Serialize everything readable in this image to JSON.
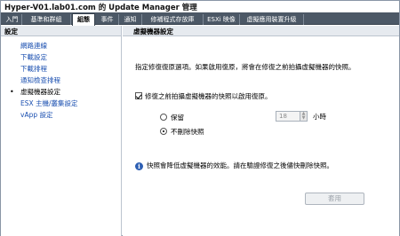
{
  "window": {
    "title": "Hyper-V01.lab01.com 的 Update Manager 管理"
  },
  "tabs": [
    {
      "label": "入門"
    },
    {
      "label": "基準和群組"
    },
    {
      "label": "組態"
    },
    {
      "label": "事件"
    },
    {
      "label": "通知"
    },
    {
      "label": "修補程式存放庫"
    },
    {
      "label": "ESXi 映像"
    },
    {
      "label": "虛擬應用裝置升級"
    }
  ],
  "sidebar": {
    "header": "設定",
    "items": [
      {
        "label": "網路連線"
      },
      {
        "label": "下載設定"
      },
      {
        "label": "下載排程"
      },
      {
        "label": "通知檢查排程"
      },
      {
        "label": "虛擬機器設定"
      },
      {
        "label": "ESX 主機/叢集設定"
      },
      {
        "label": "vApp 設定"
      }
    ],
    "selected_index": 4
  },
  "main": {
    "header": "虛擬機器設定",
    "description": "指定修復復原選項。如果啟用復原，將會在修復之前拍攝虛擬機器的快照。",
    "snapshot_checkbox": {
      "label": "修復之前拍攝虛擬機器的快照以啟用復原。",
      "checked": true
    },
    "retention": {
      "keep_label": "保留",
      "keep_value": "18",
      "keep_unit": "小時",
      "no_delete_label": "不刪除快照",
      "selected": "no_delete"
    },
    "info_text": "快照會降低虛擬機器的效能。請在驗證修復之後儘快刪除快照。",
    "apply_label": "套用"
  },
  "colors": {
    "tab_bar": "#4c5866",
    "link": "#1a4fb0",
    "header_bg": "#e6eaef",
    "info_icon": "#2d5fb3"
  }
}
